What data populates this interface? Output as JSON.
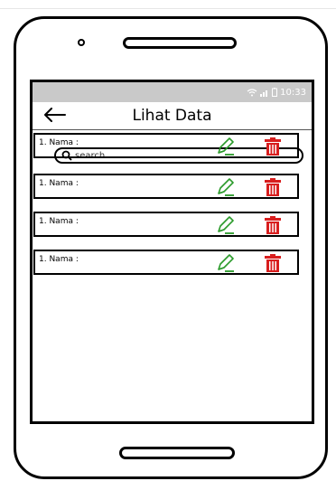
{
  "status_bar": {
    "time": "10:33"
  },
  "header": {
    "title": "Lihat Data"
  },
  "search": {
    "placeholder": "search"
  },
  "list": {
    "items": [
      {
        "label": "1. Nama :"
      },
      {
        "label": "1. Nama :"
      },
      {
        "label": "1. Nama :"
      },
      {
        "label": "1. Nama :"
      }
    ]
  },
  "colors": {
    "edit_icon": "#2a9a2a",
    "delete_icon": "#d81e1e",
    "status_bar": "#c9c9c9"
  },
  "icons": {
    "back": "arrow-left-icon",
    "search": "search-icon",
    "edit": "pencil-icon",
    "delete": "trash-icon"
  }
}
